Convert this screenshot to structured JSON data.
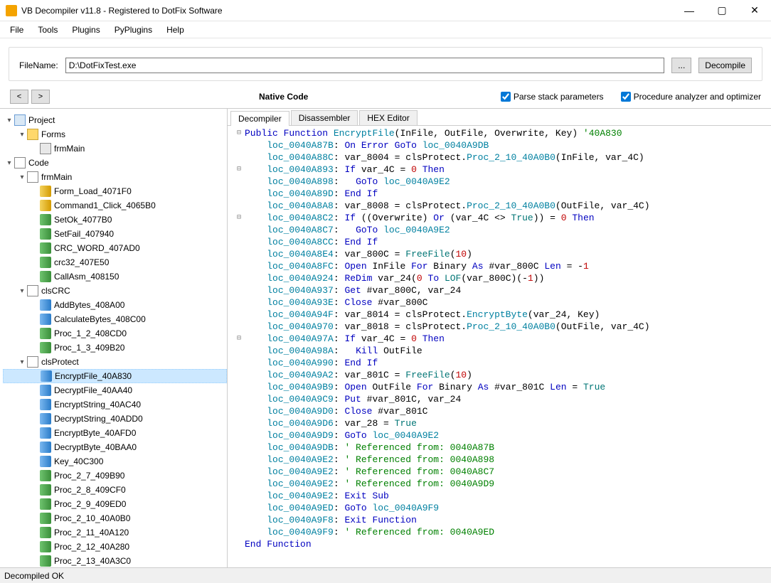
{
  "window": {
    "title": "VB Decompiler v11.8 - Registered to DotFix Software"
  },
  "menu": {
    "file": "File",
    "tools": "Tools",
    "plugins": "Plugins",
    "pyplugins": "PyPlugins",
    "help": "Help"
  },
  "toolbar": {
    "filename_label": "FileName:",
    "filename_value": "D:\\DotFixTest.exe",
    "browse": "...",
    "decompile": "Decompile"
  },
  "nav": {
    "back": "<",
    "forward": ">",
    "native_label": "Native Code",
    "parse_stack": "Parse stack parameters",
    "proc_analyzer": "Procedure analyzer and optimizer"
  },
  "tabs": {
    "decompiler": "Decompiler",
    "disassembler": "Disassembler",
    "hex": "HEX Editor"
  },
  "tree": {
    "project": "Project",
    "forms": "Forms",
    "frmMain_form": "frmMain",
    "code": "Code",
    "frmMain_code": "frmMain",
    "frmMain_items": [
      "Form_Load_4071F0",
      "Command1_Click_4065B0",
      "SetOk_4077B0",
      "SetFail_407940",
      "CRC_WORD_407AD0",
      "crc32_407E50",
      "CallAsm_408150"
    ],
    "clsCRC": "clsCRC",
    "clsCRC_items": [
      "AddBytes_408A00",
      "CalculateBytes_408C00",
      "Proc_1_2_408CD0",
      "Proc_1_3_409B20"
    ],
    "clsProtect": "clsProtect",
    "clsProtect_items": [
      "EncryptFile_40A830",
      "DecryptFile_40AA40",
      "EncryptString_40AC40",
      "DecryptString_40ADD0",
      "EncryptByte_40AFD0",
      "DecryptByte_40BAA0",
      "Key_40C300",
      "Proc_2_7_409B90",
      "Proc_2_8_409CF0",
      "Proc_2_9_409ED0",
      "Proc_2_10_40A0B0",
      "Proc_2_11_40A120",
      "Proc_2_12_40A280",
      "Proc_2_13_40A3C0"
    ]
  },
  "code_lines": [
    {
      "gut": "⊟",
      "html": "<span class='k-blue'>Public Function</span> <span class='k-cyan'>EncryptFile</span>(InFile, OutFile, Overwrite, Key) <span class='k-comment'>'40A830</span>"
    },
    {
      "gut": "",
      "html": "    <span class='k-cyan'>loc_0040A87B</span>: <span class='k-blue'>On Error GoTo</span> <span class='k-cyan'>loc_0040A9DB</span>"
    },
    {
      "gut": "",
      "html": "    <span class='k-cyan'>loc_0040A88C</span>: var_8004 = clsProtect.<span class='k-cyan'>Proc_2_10_40A0B0</span>(InFile, var_4C)"
    },
    {
      "gut": "⊟",
      "html": "    <span class='k-cyan'>loc_0040A893</span>: <span class='k-blue'>If</span> var_4C = <span class='k-num'>0</span> <span class='k-blue'>Then</span>"
    },
    {
      "gut": "",
      "html": "    <span class='k-cyan'>loc_0040A898</span>:   <span class='k-blue'>GoTo</span> <span class='k-cyan'>loc_0040A9E2</span>"
    },
    {
      "gut": "",
      "html": "    <span class='k-cyan'>loc_0040A89D</span>: <span class='k-blue'>End If</span>"
    },
    {
      "gut": "",
      "html": "    <span class='k-cyan'>loc_0040A8A8</span>: var_8008 = clsProtect.<span class='k-cyan'>Proc_2_10_40A0B0</span>(OutFile, var_4C)"
    },
    {
      "gut": "⊟",
      "html": "    <span class='k-cyan'>loc_0040A8C2</span>: <span class='k-blue'>If</span> ((Overwrite) <span class='k-blue'>Or</span> (var_4C &lt;&gt; <span class='k-teal'>True</span>)) = <span class='k-num'>0</span> <span class='k-blue'>Then</span>"
    },
    {
      "gut": "",
      "html": "    <span class='k-cyan'>loc_0040A8C7</span>:   <span class='k-blue'>GoTo</span> <span class='k-cyan'>loc_0040A9E2</span>"
    },
    {
      "gut": "",
      "html": "    <span class='k-cyan'>loc_0040A8CC</span>: <span class='k-blue'>End If</span>"
    },
    {
      "gut": "",
      "html": "    <span class='k-cyan'>loc_0040A8E4</span>: var_800C = <span class='k-teal'>FreeFile</span>(<span class='k-num'>10</span>)"
    },
    {
      "gut": "",
      "html": "    <span class='k-cyan'>loc_0040A8FC</span>: <span class='k-blue'>Open</span> InFile <span class='k-blue'>For</span> Binary <span class='k-blue'>As</span> #var_800C <span class='k-blue'>Len</span> = -<span class='k-num'>1</span>"
    },
    {
      "gut": "",
      "html": "    <span class='k-cyan'>loc_0040A924</span>: <span class='k-blue'>ReDim</span> var_24(<span class='k-num'>0</span> <span class='k-blue'>To</span> <span class='k-teal'>LOF</span>(var_800C)(-<span class='k-num'>1</span>))"
    },
    {
      "gut": "",
      "html": "    <span class='k-cyan'>loc_0040A937</span>: <span class='k-blue'>Get</span> #var_800C, var_24"
    },
    {
      "gut": "",
      "html": "    <span class='k-cyan'>loc_0040A93E</span>: <span class='k-blue'>Close</span> #var_800C"
    },
    {
      "gut": "",
      "html": "    <span class='k-cyan'>loc_0040A94F</span>: var_8014 = clsProtect.<span class='k-cyan'>EncryptByte</span>(var_24, Key)"
    },
    {
      "gut": "",
      "html": "    <span class='k-cyan'>loc_0040A970</span>: var_8018 = clsProtect.<span class='k-cyan'>Proc_2_10_40A0B0</span>(OutFile, var_4C)"
    },
    {
      "gut": "⊟",
      "html": "    <span class='k-cyan'>loc_0040A97A</span>: <span class='k-blue'>If</span> var_4C = <span class='k-num'>0</span> <span class='k-blue'>Then</span>"
    },
    {
      "gut": "",
      "html": "    <span class='k-cyan'>loc_0040A98A</span>:   <span class='k-blue'>Kill</span> OutFile"
    },
    {
      "gut": "",
      "html": "    <span class='k-cyan'>loc_0040A990</span>: <span class='k-blue'>End If</span>"
    },
    {
      "gut": "",
      "html": "    <span class='k-cyan'>loc_0040A9A2</span>: var_801C = <span class='k-teal'>FreeFile</span>(<span class='k-num'>10</span>)"
    },
    {
      "gut": "",
      "html": "    <span class='k-cyan'>loc_0040A9B9</span>: <span class='k-blue'>Open</span> OutFile <span class='k-blue'>For</span> Binary <span class='k-blue'>As</span> #var_801C <span class='k-blue'>Len</span> = <span class='k-teal'>True</span>"
    },
    {
      "gut": "",
      "html": "    <span class='k-cyan'>loc_0040A9C9</span>: <span class='k-blue'>Put</span> #var_801C, var_24"
    },
    {
      "gut": "",
      "html": "    <span class='k-cyan'>loc_0040A9D0</span>: <span class='k-blue'>Close</span> #var_801C"
    },
    {
      "gut": "",
      "html": "    <span class='k-cyan'>loc_0040A9D6</span>: var_28 = <span class='k-teal'>True</span>"
    },
    {
      "gut": "",
      "html": "    <span class='k-cyan'>loc_0040A9D9</span>: <span class='k-blue'>GoTo</span> <span class='k-cyan'>loc_0040A9E2</span>"
    },
    {
      "gut": "",
      "html": "    <span class='k-cyan'>loc_0040A9DB</span>: <span class='k-comment'>' Referenced from: 0040A87B</span>"
    },
    {
      "gut": "",
      "html": "    <span class='k-cyan'>loc_0040A9E2</span>: <span class='k-comment'>' Referenced from: 0040A898</span>"
    },
    {
      "gut": "",
      "html": "    <span class='k-cyan'>loc_0040A9E2</span>: <span class='k-comment'>' Referenced from: 0040A8C7</span>"
    },
    {
      "gut": "",
      "html": "    <span class='k-cyan'>loc_0040A9E2</span>: <span class='k-comment'>' Referenced from: 0040A9D9</span>"
    },
    {
      "gut": "",
      "html": "    <span class='k-cyan'>loc_0040A9E2</span>: <span class='k-blue'>Exit Sub</span>"
    },
    {
      "gut": "",
      "html": "    <span class='k-cyan'>loc_0040A9ED</span>: <span class='k-blue'>GoTo</span> <span class='k-cyan'>loc_0040A9F9</span>"
    },
    {
      "gut": "",
      "html": "    <span class='k-cyan'>loc_0040A9F8</span>: <span class='k-blue'>Exit Function</span>"
    },
    {
      "gut": "",
      "html": "    <span class='k-cyan'>loc_0040A9F9</span>: <span class='k-comment'>' Referenced from: 0040A9ED</span>"
    },
    {
      "gut": "",
      "html": "<span class='k-blue'>End Function</span>"
    }
  ],
  "status": {
    "text": "Decompiled OK"
  }
}
